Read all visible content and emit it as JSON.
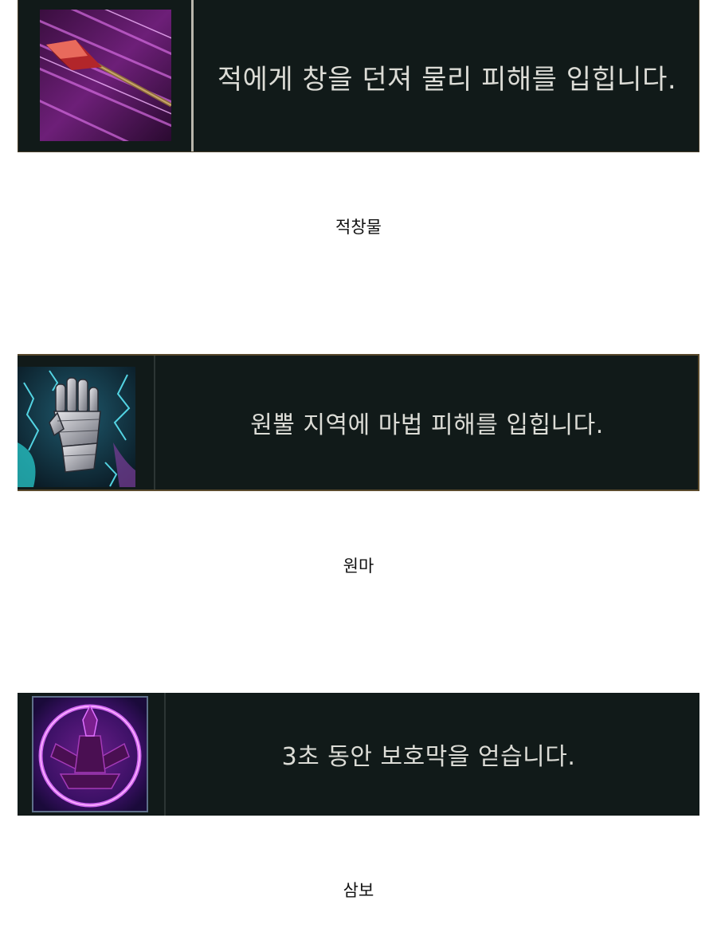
{
  "items": [
    {
      "description": "적에게 창을 던져 물리 피해를 입힙니다.",
      "caption": "적창물",
      "icon": "spear-icon"
    },
    {
      "description": "원뿔 지역에 마법 피해를 입힙니다.",
      "caption": "원마",
      "icon": "gauntlet-icon"
    },
    {
      "description": "3초 동안 보호막을 얻습니다.",
      "caption": "삼보",
      "icon": "shield-orb-icon"
    }
  ],
  "colors": {
    "card_bg": "#111a19",
    "text": "#dcdcd6"
  }
}
